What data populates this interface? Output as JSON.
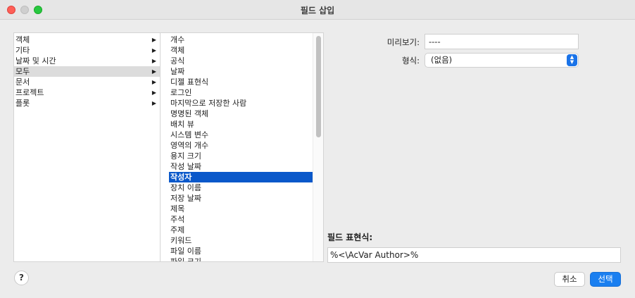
{
  "window": {
    "title": "필드 삽입"
  },
  "categories": [
    {
      "label": "객체",
      "selected": false
    },
    {
      "label": "기타",
      "selected": false
    },
    {
      "label": "날짜 및 시간",
      "selected": false
    },
    {
      "label": "모두",
      "selected": true
    },
    {
      "label": "문서",
      "selected": false
    },
    {
      "label": "프로젝트",
      "selected": false
    },
    {
      "label": "플롯",
      "selected": false
    }
  ],
  "fields": [
    {
      "label": "개수",
      "selected": false
    },
    {
      "label": "객체",
      "selected": false
    },
    {
      "label": "공식",
      "selected": false
    },
    {
      "label": "날짜",
      "selected": false
    },
    {
      "label": "디젤 표현식",
      "selected": false
    },
    {
      "label": "로그인",
      "selected": false
    },
    {
      "label": "마지막으로 저장한 사람",
      "selected": false
    },
    {
      "label": "명명된 객체",
      "selected": false
    },
    {
      "label": "배치 뷰",
      "selected": false
    },
    {
      "label": "시스템 변수",
      "selected": false
    },
    {
      "label": "영역의 개수",
      "selected": false
    },
    {
      "label": "용지 크기",
      "selected": false
    },
    {
      "label": "작성 날짜",
      "selected": false
    },
    {
      "label": "작성자",
      "selected": true
    },
    {
      "label": "장치 이름",
      "selected": false
    },
    {
      "label": "저장 날짜",
      "selected": false
    },
    {
      "label": "제목",
      "selected": false
    },
    {
      "label": "주석",
      "selected": false
    },
    {
      "label": "주제",
      "selected": false
    },
    {
      "label": "키워드",
      "selected": false
    },
    {
      "label": "파일 이름",
      "selected": false
    },
    {
      "label": "파일 크기",
      "selected": false
    }
  ],
  "preview": {
    "label": "미리보기:",
    "value": "----"
  },
  "format": {
    "label": "형식:",
    "value": "(없음)"
  },
  "expression": {
    "label": "필드 표현식:",
    "value": "%<\\AcVar Author>%"
  },
  "buttons": {
    "help": "?",
    "cancel": "취소",
    "select": "선택"
  },
  "icons": {
    "submenu_arrow": "▶",
    "stepper": "⌃⌄"
  }
}
